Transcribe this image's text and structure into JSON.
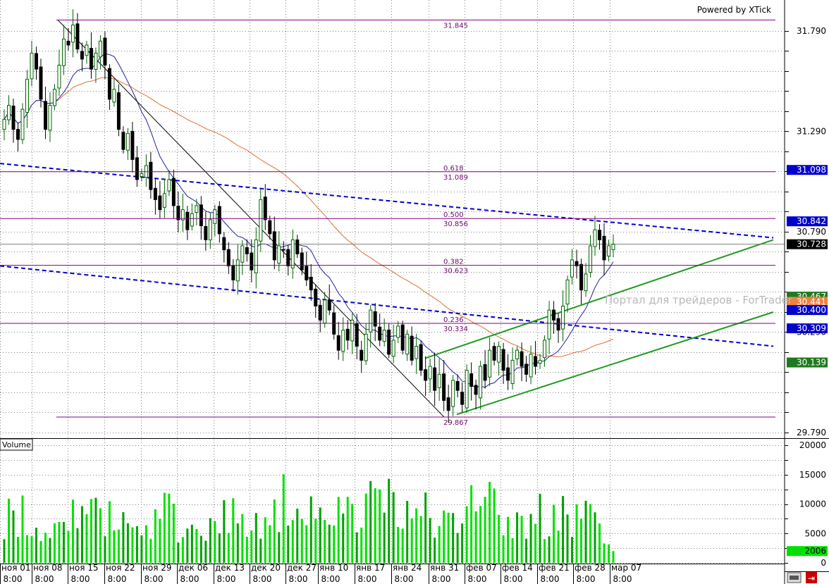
{
  "header": {
    "powered_by": "Powered by XTick"
  },
  "watermark": "Портал для трейдеров - ForTrader",
  "price_axis": {
    "ticks": [
      "31.790",
      "31.290",
      "30.790",
      "30.290",
      "29.790"
    ]
  },
  "volume_axis": {
    "label": "Volume",
    "ticks": [
      "20000",
      "15000",
      "10000",
      "5000",
      "0"
    ],
    "current": "2006"
  },
  "date_axis": {
    "labels": [
      "ноя 01",
      "ноя 08",
      "ноя 15",
      "ноя 22",
      "ноя 29",
      "дек 06",
      "дек 13",
      "дек 20",
      "дек 27",
      "янв 10",
      "янв 17",
      "янв 24",
      "янв 31",
      "фев 07",
      "фев 14",
      "фев 21",
      "фев 28",
      "мар 07"
    ],
    "time": "8:00"
  },
  "fib_levels": [
    {
      "ratio": "",
      "price": "31.845"
    },
    {
      "ratio": "0.618",
      "price": "31.089"
    },
    {
      "ratio": "0.500",
      "price": "30.856"
    },
    {
      "ratio": "0.382",
      "price": "30.623"
    },
    {
      "ratio": "0.236",
      "price": "30.334"
    },
    {
      "ratio": "",
      "price": "29.867"
    }
  ],
  "price_flags": [
    {
      "text": "31.098",
      "bg": "#0000cc",
      "fg": "#ffffff"
    },
    {
      "text": "30.842",
      "bg": "#0000cc",
      "fg": "#ffffff"
    },
    {
      "text": "30.728",
      "bg": "#000000",
      "fg": "#ffffff"
    },
    {
      "text": "30.467",
      "bg": "#1f7a1f",
      "fg": "#ffffff"
    },
    {
      "text": "30.441",
      "bg": "#f08040",
      "fg": "#ffffff"
    },
    {
      "text": "30.400",
      "bg": "#0000cc",
      "fg": "#ffffff"
    },
    {
      "text": "30.309",
      "bg": "#0000cc",
      "fg": "#ffffff"
    },
    {
      "text": "30.139",
      "bg": "#1f7a1f",
      "fg": "#ffffff"
    }
  ],
  "colors": {
    "bull": "#006400",
    "bear": "#000000",
    "ma_fast": "#2020a0",
    "ma_slow": "#e07030",
    "channel": "#0000cc",
    "trend": "#1f9a1f",
    "fib": "#800080",
    "volume": "#00e000",
    "volume_dark": "#00a000"
  },
  "chart_data": {
    "type": "candlestick",
    "instrument_scale": {
      "price_min": 29.79,
      "price_max": 31.79
    },
    "price_range_shown": [
      29.7,
      31.85
    ],
    "volume_range": [
      0,
      20000
    ],
    "high": 31.845,
    "low": 29.867,
    "last": 30.728,
    "fib_retracement": {
      "from": 31.845,
      "to": 29.867,
      "levels": {
        "0.236": 30.334,
        "0.382": 30.623,
        "0.500": 30.856,
        "0.618": 31.089
      }
    },
    "closes": [
      31.35,
      31.42,
      31.3,
      31.25,
      31.4,
      31.55,
      31.68,
      31.6,
      31.45,
      31.3,
      31.42,
      31.5,
      31.62,
      31.75,
      31.72,
      31.82,
      31.7,
      31.65,
      31.72,
      31.6,
      31.68,
      31.74,
      31.62,
      31.45,
      31.5,
      31.3,
      31.2,
      31.28,
      31.15,
      31.05,
      31.08,
      31.12,
      31.0,
      30.95,
      30.9,
      30.98,
      31.05,
      30.92,
      30.85,
      30.9,
      30.8,
      30.88,
      30.92,
      30.82,
      30.75,
      30.85,
      30.9,
      30.78,
      30.7,
      30.62,
      30.55,
      30.65,
      30.72,
      30.68,
      30.6,
      30.75,
      30.95,
      30.85,
      30.78,
      30.65,
      30.72,
      30.7,
      30.62,
      30.75,
      30.68,
      30.6,
      30.55,
      30.5,
      30.42,
      30.35,
      30.45,
      30.4,
      30.28,
      30.2,
      30.3,
      30.25,
      30.35,
      30.22,
      30.15,
      30.28,
      30.4,
      30.32,
      30.25,
      30.3,
      30.18,
      30.25,
      30.32,
      30.2,
      30.28,
      30.15,
      30.22,
      30.1,
      30.05,
      30.12,
      30.0,
      30.08,
      29.95,
      29.9,
      30.05,
      30.0,
      29.93,
      30.1,
      30.02,
      29.98,
      30.12,
      30.05,
      30.2,
      30.15,
      30.22,
      30.1,
      30.05,
      30.15,
      30.2,
      30.12,
      30.08,
      30.18,
      30.12,
      30.15,
      30.25,
      30.4,
      30.35,
      30.3,
      30.42,
      30.55,
      30.65,
      30.62,
      30.5,
      30.58,
      30.72,
      30.8,
      30.75,
      30.65,
      30.72,
      30.728
    ]
  }
}
